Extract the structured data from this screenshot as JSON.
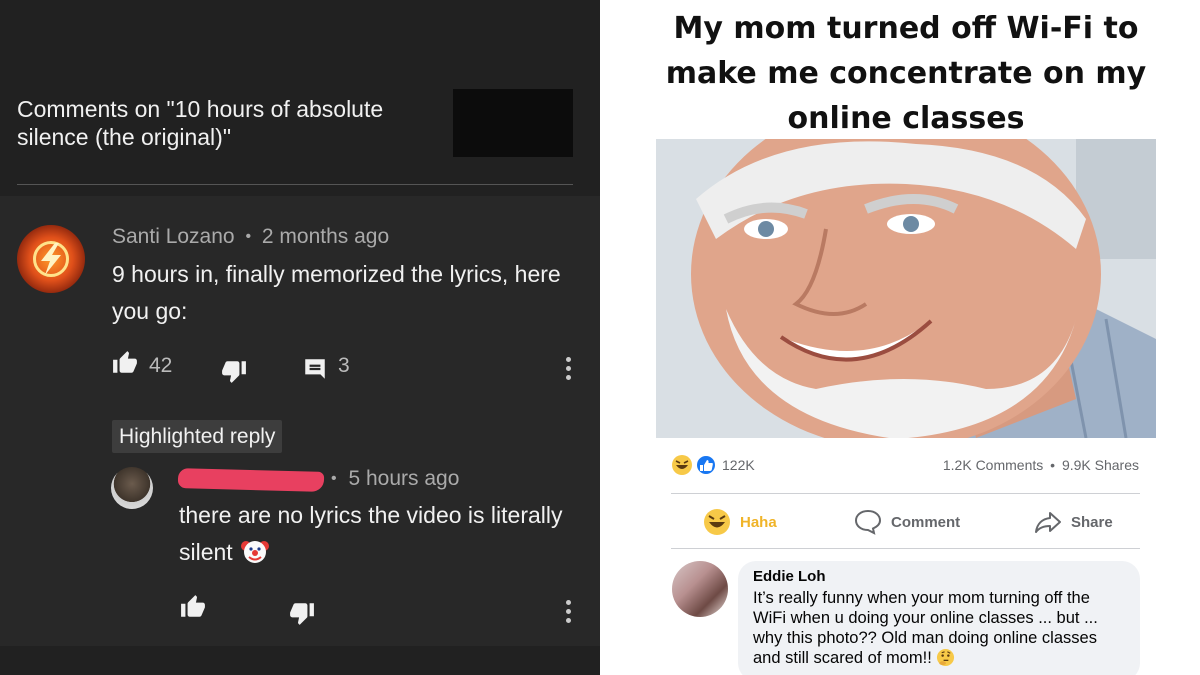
{
  "youtube": {
    "header_title": "Comments on \"10 hours of absolute silence (the original)\"",
    "comment": {
      "author": "Santi Lozano",
      "time": "2 months ago",
      "text": "9 hours in, finally memorized the lyrics, here you go:",
      "likes": "42",
      "replies": "3",
      "avatar_icon": "flash-logo-icon"
    },
    "highlighted_label": "Highlighted reply",
    "reply": {
      "time": "5 hours ago",
      "text": "there are no lyrics the video is literally silent",
      "emoji": "clown-face-icon"
    },
    "separator": "•",
    "colors": {
      "background": "#282828",
      "header": "#212121",
      "redaction": "#e84060"
    }
  },
  "facebook": {
    "meme_caption": "My mom turned off Wi-Fi to make me concentrate on my online classes",
    "reactions_count": "122K",
    "comments_count": "1.2K Comments",
    "shares_count": "9.9K Shares",
    "separator": "•",
    "actions": {
      "haha": "Haha",
      "comment": "Comment",
      "share": "Share"
    },
    "top_comment": {
      "author": "Eddie Loh",
      "text": "It’s really funny when your mom turning off the WiFi when u doing your online classes ... but ... why this photo?? Old man doing online classes and still scared of mom!!",
      "emoji": "thinking-face-icon"
    },
    "colors": {
      "haha": "#f0b429",
      "like_blue": "#1877f2",
      "muted": "#65676b"
    }
  }
}
